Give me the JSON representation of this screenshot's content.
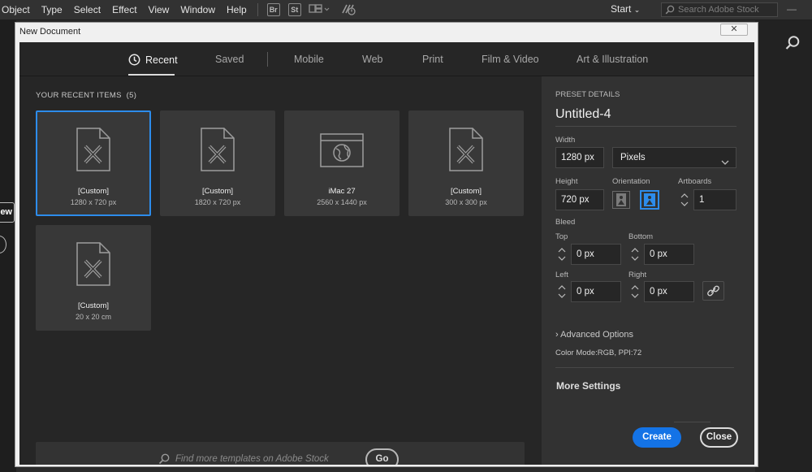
{
  "menubar": {
    "items": [
      "Object",
      "Type",
      "Select",
      "Effect",
      "View",
      "Window",
      "Help"
    ],
    "badges": [
      "Br",
      "St"
    ],
    "start_label": "Start",
    "stock_search_placeholder": "Search Adobe Stock"
  },
  "background": {
    "partial_button_label": "ew"
  },
  "dialog": {
    "title": "New Document",
    "close_glyph": "✕",
    "tabs": [
      "Recent",
      "Saved",
      "Mobile",
      "Web",
      "Print",
      "Film & Video",
      "Art & Illustration"
    ],
    "active_tab": "Recent",
    "recent": {
      "heading": "YOUR RECENT ITEMS",
      "count": "(5)",
      "items": [
        {
          "name": "[Custom]",
          "dims": "1280 x 720 px",
          "icon": "document-pencil-icon",
          "selected": true
        },
        {
          "name": "[Custom]",
          "dims": "1820 x 720 px",
          "icon": "document-pencil-icon",
          "selected": false
        },
        {
          "name": "iMac 27",
          "dims": "2560 x 1440 px",
          "icon": "browser-globe-icon",
          "selected": false
        },
        {
          "name": "[Custom]",
          "dims": "300 x 300 px",
          "icon": "document-pencil-icon",
          "selected": false
        },
        {
          "name": "[Custom]",
          "dims": "20 x 20 cm",
          "icon": "document-pencil-icon",
          "selected": false
        }
      ]
    },
    "template_search": {
      "placeholder": "Find more templates on Adobe Stock",
      "go_label": "Go"
    },
    "preset": {
      "heading": "PRESET DETAILS",
      "doc_name": "Untitled-4",
      "width_label": "Width",
      "width_value": "1280 px",
      "units_value": "Pixels",
      "height_label": "Height",
      "height_value": "720 px",
      "orientation_label": "Orientation",
      "artboards_label": "Artboards",
      "artboards_value": "1",
      "bleed_label": "Bleed",
      "top_label": "Top",
      "top_value": "0 px",
      "bottom_label": "Bottom",
      "bottom_value": "0 px",
      "left_label": "Left",
      "left_value": "0 px",
      "right_label": "Right",
      "right_value": "0 px",
      "advanced_label": "Advanced Options",
      "color_mode": "Color Mode:RGB, PPI:72",
      "more_settings": "More Settings",
      "create_label": "Create",
      "close_label": "Close"
    }
  },
  "colors": {
    "accent": "#1473e6",
    "selection": "#2d8ceb",
    "panel": "#323232",
    "background": "#262626"
  }
}
